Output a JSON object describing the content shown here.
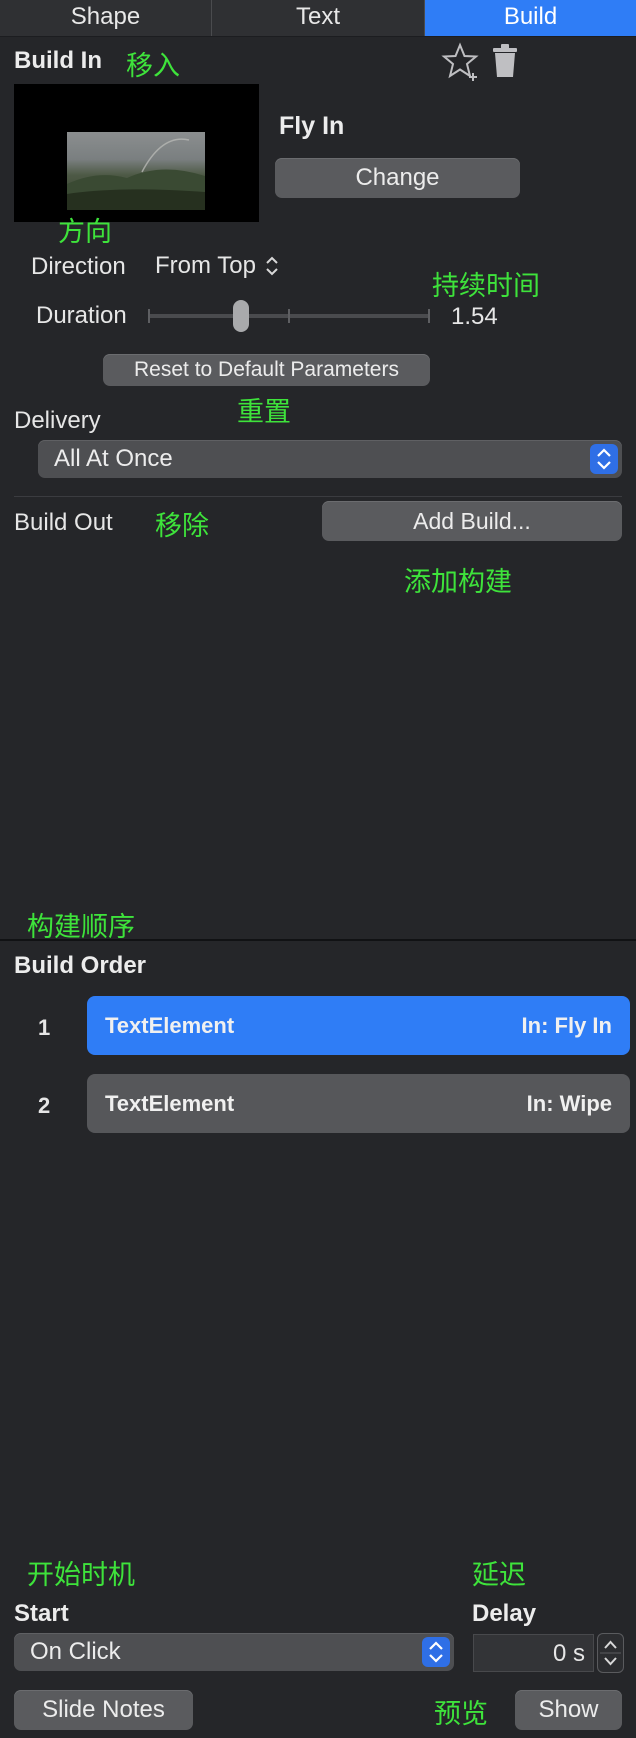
{
  "tabs": [
    {
      "label": "Shape"
    },
    {
      "label": "Text"
    },
    {
      "label": "Build"
    }
  ],
  "build_in": {
    "title": "Build In",
    "annotation": "移入",
    "effect_name": "Fly In",
    "change_label": "Change",
    "direction_annotation": "方向",
    "direction_label": "Direction",
    "direction_value": "From Top",
    "duration_annotation": "持续时间",
    "duration_label": "Duration",
    "duration_value": "1.54",
    "duration_fraction": 0.32,
    "reset_label": "Reset to Default Parameters",
    "reset_annotation": "重置",
    "delivery_label": "Delivery",
    "delivery_value": "All At Once"
  },
  "build_out": {
    "title": "Build Out",
    "annotation": "移除",
    "add_label": "Add Build...",
    "add_annotation": "添加构建"
  },
  "build_order": {
    "annotation": "构建顺序",
    "title": "Build Order",
    "items": [
      {
        "index": "1",
        "name": "TextElement",
        "effect": "In: Fly In",
        "selected": true
      },
      {
        "index": "2",
        "name": "TextElement",
        "effect": "In: Wipe",
        "selected": false
      }
    ]
  },
  "footer": {
    "start_annotation": "开始时机",
    "delay_annotation": "延迟",
    "start_label": "Start",
    "start_value": "On Click",
    "delay_label": "Delay",
    "delay_value": "0 s",
    "slide_notes_label": "Slide Notes",
    "preview_annotation": "预览",
    "show_label": "Show"
  },
  "colors": {
    "accent": "#2f7df6",
    "panel_bg": "#252629",
    "annotation": "#3ee33b"
  }
}
